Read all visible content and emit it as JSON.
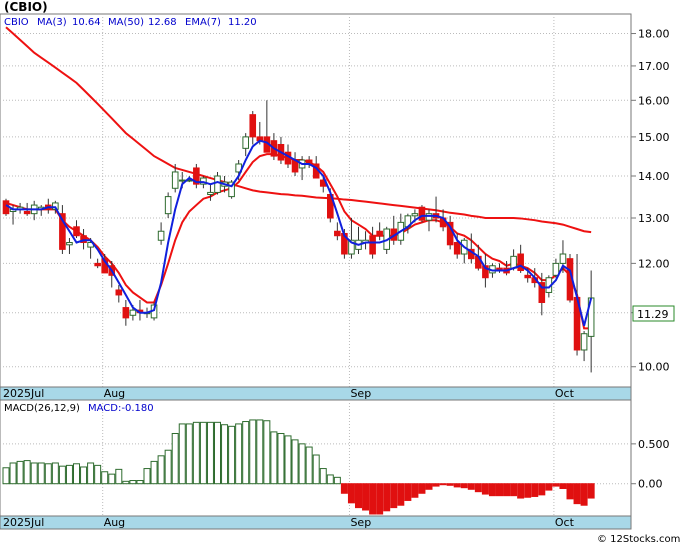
{
  "title": "(CBIO)",
  "legend": {
    "symbol": "CBIO",
    "ma3": "MA(3)",
    "ma3_value": "10.64",
    "ma50": "MA(50)",
    "ma50_value": "12.68",
    "ema7": "EMA(7)",
    "ema7_value": "11.20"
  },
  "macd_legend": {
    "params": "MACD(26,12,9)",
    "value_label": "MACD:-0.180"
  },
  "last_price": "11.29",
  "month_labels": [
    "2025Jul",
    "Aug",
    "Sep",
    "Oct"
  ],
  "credit": "© 12Stocks.com",
  "colors": {
    "up_candle": "#2e6b2e",
    "down_candle": "#e01010",
    "ma50": "#ee1111",
    "ema7": "#ee1111",
    "ma3": "#1020dd",
    "axis_band": "#a8d8e8",
    "macd_pos": "#2e6b2e",
    "macd_neg": "#e01010",
    "price_box_border": "#2a8a2a"
  },
  "chart_data": [
    {
      "type": "candlestick",
      "title": "(CBIO)",
      "y_axis_side": "right",
      "ylim": [
        9.7,
        18.5
      ],
      "ylabels": [
        "18.00",
        "17.00",
        "16.00",
        "15.00",
        "14.00",
        "13.00",
        "12.00",
        "11.00",
        "10.00"
      ],
      "yticks": [
        18,
        17,
        16,
        15,
        14,
        13,
        12,
        11,
        10
      ],
      "y_scale": "log",
      "x_labels": [
        "2025Jul",
        "Aug",
        "Sep",
        "Oct"
      ],
      "x_label_index": [
        0,
        14,
        49,
        78
      ],
      "candles": [
        [
          13.4,
          13.45,
          13.05,
          13.1
        ],
        [
          13.15,
          13.3,
          12.85,
          13.2
        ],
        [
          13.2,
          13.35,
          13.1,
          13.25
        ],
        [
          13.15,
          13.35,
          13.05,
          13.1
        ],
        [
          13.1,
          13.4,
          12.95,
          13.3
        ],
        [
          13.2,
          13.3,
          13.05,
          13.25
        ],
        [
          13.3,
          13.45,
          13.1,
          13.2
        ],
        [
          13.2,
          13.4,
          13.1,
          13.35
        ],
        [
          13.1,
          13.3,
          12.2,
          12.3
        ],
        [
          12.4,
          12.55,
          12.2,
          12.45
        ],
        [
          12.8,
          12.95,
          12.55,
          12.6
        ],
        [
          12.6,
          12.75,
          12.3,
          12.45
        ],
        [
          12.35,
          12.55,
          12.1,
          12.45
        ],
        [
          12.0,
          12.1,
          11.9,
          11.95
        ],
        [
          12.1,
          12.2,
          11.8,
          11.8
        ],
        [
          11.95,
          12.05,
          11.5,
          11.75
        ],
        [
          11.45,
          11.55,
          11.2,
          11.35
        ],
        [
          11.1,
          11.25,
          10.75,
          10.9
        ],
        [
          10.95,
          11.15,
          10.85,
          11.05
        ],
        [
          11.05,
          11.25,
          10.85,
          11.0
        ],
        [
          11.0,
          11.1,
          10.9,
          11.0
        ],
        [
          10.9,
          11.2,
          10.85,
          11.15
        ],
        [
          12.5,
          12.9,
          12.4,
          12.7
        ],
        [
          13.1,
          13.6,
          13.0,
          13.5
        ],
        [
          13.7,
          14.3,
          13.6,
          14.1
        ],
        [
          13.9,
          14.1,
          13.7,
          13.9
        ],
        [
          13.9,
          14.0,
          13.85,
          13.9
        ],
        [
          14.2,
          14.3,
          13.7,
          13.8
        ],
        [
          13.8,
          14.0,
          13.7,
          13.95
        ],
        [
          13.55,
          13.8,
          13.4,
          13.6
        ],
        [
          13.6,
          14.1,
          13.55,
          14.0
        ],
        [
          13.75,
          14.0,
          13.6,
          13.85
        ],
        [
          13.5,
          13.9,
          13.45,
          13.85
        ],
        [
          14.1,
          14.4,
          13.9,
          14.3
        ],
        [
          14.7,
          15.1,
          14.5,
          15.0
        ],
        [
          15.6,
          15.7,
          14.8,
          15.0
        ],
        [
          15.0,
          15.4,
          14.8,
          14.9
        ],
        [
          15.0,
          16.0,
          14.6,
          14.6
        ],
        [
          14.9,
          15.1,
          14.4,
          14.5
        ],
        [
          14.8,
          15.0,
          14.3,
          14.4
        ],
        [
          14.6,
          14.8,
          14.2,
          14.3
        ],
        [
          14.4,
          14.6,
          14.0,
          14.1
        ],
        [
          14.2,
          14.5,
          13.9,
          14.4
        ],
        [
          14.4,
          14.5,
          14.2,
          14.3
        ],
        [
          14.3,
          14.5,
          13.95,
          13.95
        ],
        [
          13.9,
          14.0,
          13.6,
          13.75
        ],
        [
          13.55,
          13.7,
          12.9,
          13.0
        ],
        [
          12.7,
          12.9,
          12.5,
          12.6
        ],
        [
          12.65,
          12.75,
          12.1,
          12.2
        ],
        [
          12.2,
          13.0,
          12.1,
          12.5
        ],
        [
          12.3,
          12.8,
          12.2,
          12.5
        ],
        [
          12.45,
          12.7,
          12.3,
          12.5
        ],
        [
          12.6,
          12.8,
          12.1,
          12.2
        ],
        [
          12.7,
          12.9,
          12.5,
          12.6
        ],
        [
          12.3,
          12.8,
          12.2,
          12.75
        ],
        [
          12.75,
          13.05,
          12.4,
          12.5
        ],
        [
          12.5,
          13.1,
          12.4,
          12.9
        ],
        [
          12.8,
          13.1,
          12.65,
          13.05
        ],
        [
          13.05,
          13.2,
          12.9,
          13.1
        ],
        [
          13.25,
          13.3,
          12.9,
          12.95
        ],
        [
          12.95,
          13.2,
          12.7,
          13.1
        ],
        [
          13.1,
          13.5,
          12.9,
          13.0
        ],
        [
          13.0,
          13.2,
          12.7,
          12.8
        ],
        [
          12.9,
          13.05,
          12.3,
          12.4
        ],
        [
          12.45,
          12.65,
          12.1,
          12.2
        ],
        [
          12.2,
          12.55,
          12.0,
          12.5
        ],
        [
          12.3,
          12.65,
          12.0,
          12.1
        ],
        [
          12.15,
          12.4,
          11.85,
          11.9
        ],
        [
          11.95,
          12.2,
          11.5,
          11.7
        ],
        [
          11.8,
          12.0,
          11.7,
          11.95
        ],
        [
          11.9,
          12.0,
          11.8,
          11.85
        ],
        [
          11.9,
          12.05,
          11.75,
          11.8
        ],
        [
          11.9,
          12.3,
          11.85,
          12.15
        ],
        [
          12.2,
          12.4,
          11.8,
          11.85
        ],
        [
          11.75,
          11.9,
          11.6,
          11.7
        ],
        [
          11.7,
          11.9,
          11.5,
          11.6
        ],
        [
          11.6,
          11.8,
          10.95,
          11.2
        ],
        [
          11.4,
          11.75,
          11.3,
          11.7
        ],
        [
          11.75,
          12.1,
          11.7,
          12.0
        ],
        [
          12.0,
          12.5,
          11.8,
          12.2
        ],
        [
          12.1,
          12.2,
          11.2,
          11.25
        ],
        [
          11.3,
          12.2,
          10.2,
          10.3
        ],
        [
          10.3,
          10.65,
          10.1,
          10.6
        ],
        [
          10.55,
          11.85,
          9.9,
          11.29
        ]
      ],
      "ma3": [
        13.3,
        13.2,
        13.2,
        13.2,
        13.2,
        13.2,
        13.25,
        13.25,
        12.95,
        12.7,
        12.45,
        12.5,
        12.5,
        12.3,
        12.05,
        11.85,
        11.6,
        11.35,
        11.1,
        11.0,
        11.0,
        11.05,
        11.6,
        12.45,
        13.2,
        13.8,
        13.95,
        13.85,
        13.85,
        13.8,
        13.85,
        13.8,
        13.75,
        14.0,
        14.4,
        14.75,
        14.9,
        14.85,
        14.7,
        14.6,
        14.5,
        14.4,
        14.3,
        14.3,
        14.2,
        14.0,
        13.6,
        13.1,
        12.6,
        12.45,
        12.4,
        12.45,
        12.45,
        12.45,
        12.5,
        12.6,
        12.7,
        12.8,
        12.95,
        13.05,
        13.05,
        13.05,
        13.0,
        12.8,
        12.5,
        12.35,
        12.25,
        12.15,
        11.9,
        11.85,
        11.85,
        11.85,
        11.9,
        11.95,
        11.85,
        11.7,
        11.5,
        11.5,
        11.65,
        11.95,
        11.85,
        11.3,
        10.75,
        11.29
      ],
      "ema7": [
        13.35,
        13.3,
        13.25,
        13.2,
        13.2,
        13.2,
        13.2,
        13.2,
        12.95,
        12.8,
        12.7,
        12.6,
        12.5,
        12.35,
        12.15,
        12.0,
        11.8,
        11.55,
        11.4,
        11.3,
        11.2,
        11.2,
        11.55,
        12.0,
        12.5,
        12.9,
        13.15,
        13.3,
        13.45,
        13.5,
        13.6,
        13.65,
        13.7,
        13.85,
        14.1,
        14.35,
        14.5,
        14.55,
        14.55,
        14.5,
        14.45,
        14.4,
        14.4,
        14.35,
        14.25,
        14.1,
        13.8,
        13.5,
        13.15,
        12.95,
        12.85,
        12.75,
        12.6,
        12.6,
        12.6,
        12.6,
        12.65,
        12.75,
        12.85,
        12.9,
        12.95,
        12.95,
        12.9,
        12.8,
        12.65,
        12.6,
        12.5,
        12.35,
        12.2,
        12.1,
        12.05,
        11.95,
        12.0,
        11.95,
        11.9,
        11.8,
        11.65,
        11.65,
        11.75,
        11.9,
        11.75,
        11.35,
        10.7,
        10.7
      ],
      "ma50": [
        18.2,
        18.0,
        17.8,
        17.6,
        17.4,
        17.25,
        17.1,
        16.95,
        16.8,
        16.65,
        16.5,
        16.3,
        16.1,
        15.9,
        15.7,
        15.5,
        15.3,
        15.1,
        14.95,
        14.8,
        14.65,
        14.5,
        14.4,
        14.3,
        14.2,
        14.15,
        14.1,
        14.05,
        14.0,
        13.95,
        13.9,
        13.85,
        13.8,
        13.75,
        13.7,
        13.65,
        13.62,
        13.6,
        13.58,
        13.56,
        13.55,
        13.53,
        13.52,
        13.5,
        13.48,
        13.47,
        13.46,
        13.45,
        13.43,
        13.42,
        13.4,
        13.38,
        13.36,
        13.34,
        13.32,
        13.3,
        13.28,
        13.26,
        13.24,
        13.22,
        13.2,
        13.18,
        13.15,
        13.12,
        13.1,
        13.08,
        13.05,
        13.03,
        13.0,
        13.0,
        13.0,
        13.0,
        13.0,
        12.99,
        12.97,
        12.95,
        12.92,
        12.9,
        12.88,
        12.85,
        12.8,
        12.75,
        12.7,
        12.68
      ]
    },
    {
      "type": "bar",
      "title": "MACD(26,12,9)",
      "y_axis_side": "right",
      "ylim": [
        -0.38,
        1.0
      ],
      "ylabels": [
        "0.500",
        "0.00"
      ],
      "yticks": [
        0.5,
        0.0
      ],
      "x_labels": [
        "2025Jul",
        "Aug",
        "Sep",
        "Oct"
      ],
      "x_label_index": [
        0,
        14,
        49,
        78
      ],
      "values": [
        0.2,
        0.26,
        0.28,
        0.29,
        0.26,
        0.26,
        0.25,
        0.26,
        0.22,
        0.23,
        0.25,
        0.21,
        0.26,
        0.23,
        0.15,
        0.12,
        0.18,
        0.03,
        0.04,
        0.04,
        0.19,
        0.28,
        0.35,
        0.42,
        0.63,
        0.75,
        0.75,
        0.77,
        0.77,
        0.77,
        0.77,
        0.74,
        0.72,
        0.75,
        0.78,
        0.8,
        0.8,
        0.79,
        0.65,
        0.63,
        0.6,
        0.55,
        0.5,
        0.46,
        0.36,
        0.19,
        0.11,
        0.08,
        -0.12,
        -0.24,
        -0.3,
        -0.33,
        -0.38,
        -0.38,
        -0.34,
        -0.3,
        -0.27,
        -0.21,
        -0.17,
        -0.12,
        -0.07,
        -0.03,
        -0.01,
        -0.02,
        -0.04,
        -0.05,
        -0.07,
        -0.1,
        -0.13,
        -0.15,
        -0.15,
        -0.15,
        -0.15,
        -0.18,
        -0.17,
        -0.16,
        -0.14,
        -0.08,
        -0.03,
        -0.06,
        -0.19,
        -0.25,
        -0.27,
        -0.18
      ]
    }
  ]
}
